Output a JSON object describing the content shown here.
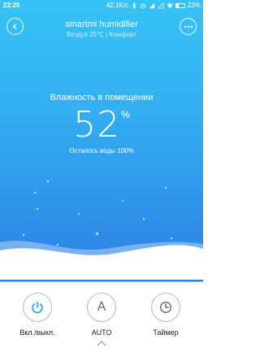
{
  "status_bar": {
    "time": "22:25",
    "net_speed": "42.1K/c",
    "battery": "23%"
  },
  "header": {
    "title": "smartmi humidifier",
    "subtitle": "Воздух 25℃ | Комфорт"
  },
  "main": {
    "humidity_label": "Влажность в помещении",
    "humidity_value": "52",
    "humidity_unit": "%",
    "water_left": "Осталось воды 100%"
  },
  "controls": {
    "power_label": "Вкл./выкл.",
    "mode_label": "AUTO",
    "mode_letter": "A",
    "timer_label": "Таймер"
  },
  "colors": {
    "bg_top": "#36c3f5",
    "bg_bottom": "#2d7fe4",
    "power_accent": "#2a9df4"
  }
}
